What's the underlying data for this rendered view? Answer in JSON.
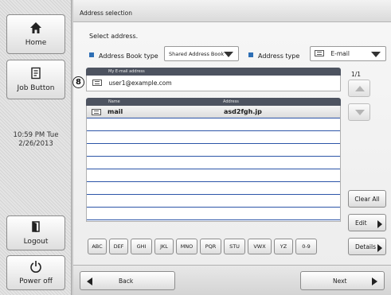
{
  "sidebar": {
    "home_label": "Home",
    "job_button_label": "Job Button",
    "clock_time": "10:59 PM Tue",
    "clock_date": "2/26/2013",
    "logout_label": "Logout",
    "power_off_label": "Power off"
  },
  "header": {
    "title": "Address selection"
  },
  "main": {
    "instruction": "Select address.",
    "address_book_type_label": "Address Book type",
    "address_book_type_value": "Shared Address Book",
    "address_type_label": "Address type",
    "address_type_value": "E-mail",
    "my_email_header": "My E-mail address",
    "my_email_value": "user1@example.com",
    "callout_number": "8",
    "columns": {
      "name": "Name",
      "address": "Address"
    },
    "rows": [
      {
        "name": "mail",
        "address": "asd2fgh.jp"
      }
    ],
    "page_indicator": "1/1"
  },
  "actions": {
    "clear_all": "Clear All",
    "edit": "Edit",
    "details": "Details"
  },
  "alpha_filters": [
    "ABC",
    "DEF",
    "GHI",
    "JKL",
    "MNO",
    "PQR",
    "STU",
    "VWX",
    "YZ",
    "0-9"
  ],
  "bottom": {
    "back": "Back",
    "next": "Next"
  }
}
